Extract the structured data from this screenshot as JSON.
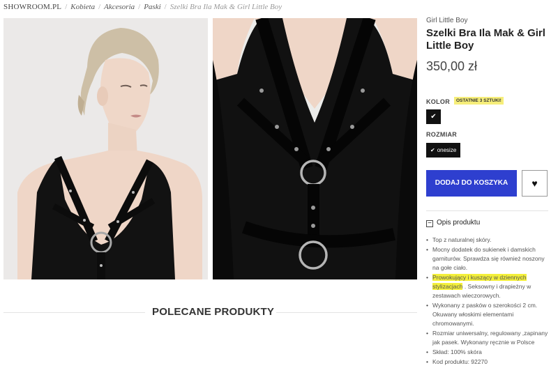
{
  "breadcrumb": {
    "items": [
      "SHOWROOM.PL",
      "Kobieta",
      "Akcesoria",
      "Paski"
    ],
    "current": "Szelki Bra Ila Mak & Girl Little Boy",
    "separator": "/"
  },
  "product": {
    "brand": "Girl Little Boy",
    "title": "Szelki Bra Ila Mak & Girl Little Boy",
    "price": "350,00 zł"
  },
  "color_section": {
    "label": "KOLOR",
    "badge": "OSTATNIE 3 SZTUKI!",
    "swatch_color": "#111111",
    "swatch_check": "✔"
  },
  "size_section": {
    "label": "ROZMIAR",
    "option_check": "✔",
    "option": "onesize"
  },
  "actions": {
    "add_to_cart": "DODAJ DO KOSZYKA",
    "add_to_cart_color": "#2e3fcf",
    "wishlist_icon": "heart-icon",
    "wishlist_glyph": "♥"
  },
  "description": {
    "header": "Opis produktu",
    "toggle_glyph": "−",
    "features": [
      {
        "text": "Top z naturalnej skóry."
      },
      {
        "text": "Mocny dodatek do sukienek i damskich garniturów. Sprawdza się również noszony na gołe ciało."
      },
      {
        "highlight": "Prowokujący i kuszący w dziennych stylizacjach",
        "text": " . Seksowny i drapieżny w zestawach wieczorowych."
      },
      {
        "text": "Wykonany z pasków o szerokości 2 cm. Okuwany włoskimi elementami chromowanymi."
      },
      {
        "text": "Rozmiar uniwersalny, regulowany ,zapinany jak pasek. Wykonany ręcznie w Polsce"
      },
      {
        "text": "Skład: 100% skóra"
      },
      {
        "text": "Kod produktu: 92270"
      }
    ],
    "highlight_color": "#f4f03a"
  },
  "recommended": {
    "title": "POLECANE PRODUKTY"
  }
}
